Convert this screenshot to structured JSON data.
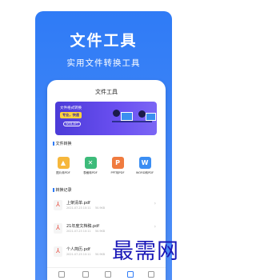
{
  "hero": {
    "title": "文件工具",
    "subtitle": "实用文件转换工具"
  },
  "app": {
    "title": "文件工具",
    "banner": {
      "title": "文件格式转换",
      "tag": "专业，快速",
      "button": "WEB-BYT"
    },
    "tools_section": "文件转换",
    "tools": [
      {
        "label": "图片转PDF",
        "color": "#f6b73c",
        "icon": "image-icon",
        "glyph": "▲"
      },
      {
        "label": "表格转PDF",
        "color": "#3dbb7a",
        "icon": "excel-icon",
        "glyph": "✕"
      },
      {
        "label": "PPT转PDF",
        "color": "#f07b3f",
        "icon": "ppt-icon",
        "glyph": "P"
      },
      {
        "label": "WORD转PDF",
        "color": "#3b8ef3",
        "icon": "word-icon",
        "glyph": "W"
      }
    ],
    "records_section": "转换记录",
    "records": [
      {
        "name": "上架清单.pdf",
        "date": "2021-07-23 10:11",
        "size": "50.9KB"
      },
      {
        "name": "21年度文档稿.pdf",
        "date": "2021-07-23 10:11",
        "size": "50.9KB"
      },
      {
        "name": "个人简历.pdf",
        "date": "2021-07-23 10:11",
        "size": "50.9KB"
      }
    ]
  },
  "watermark": "最需网"
}
